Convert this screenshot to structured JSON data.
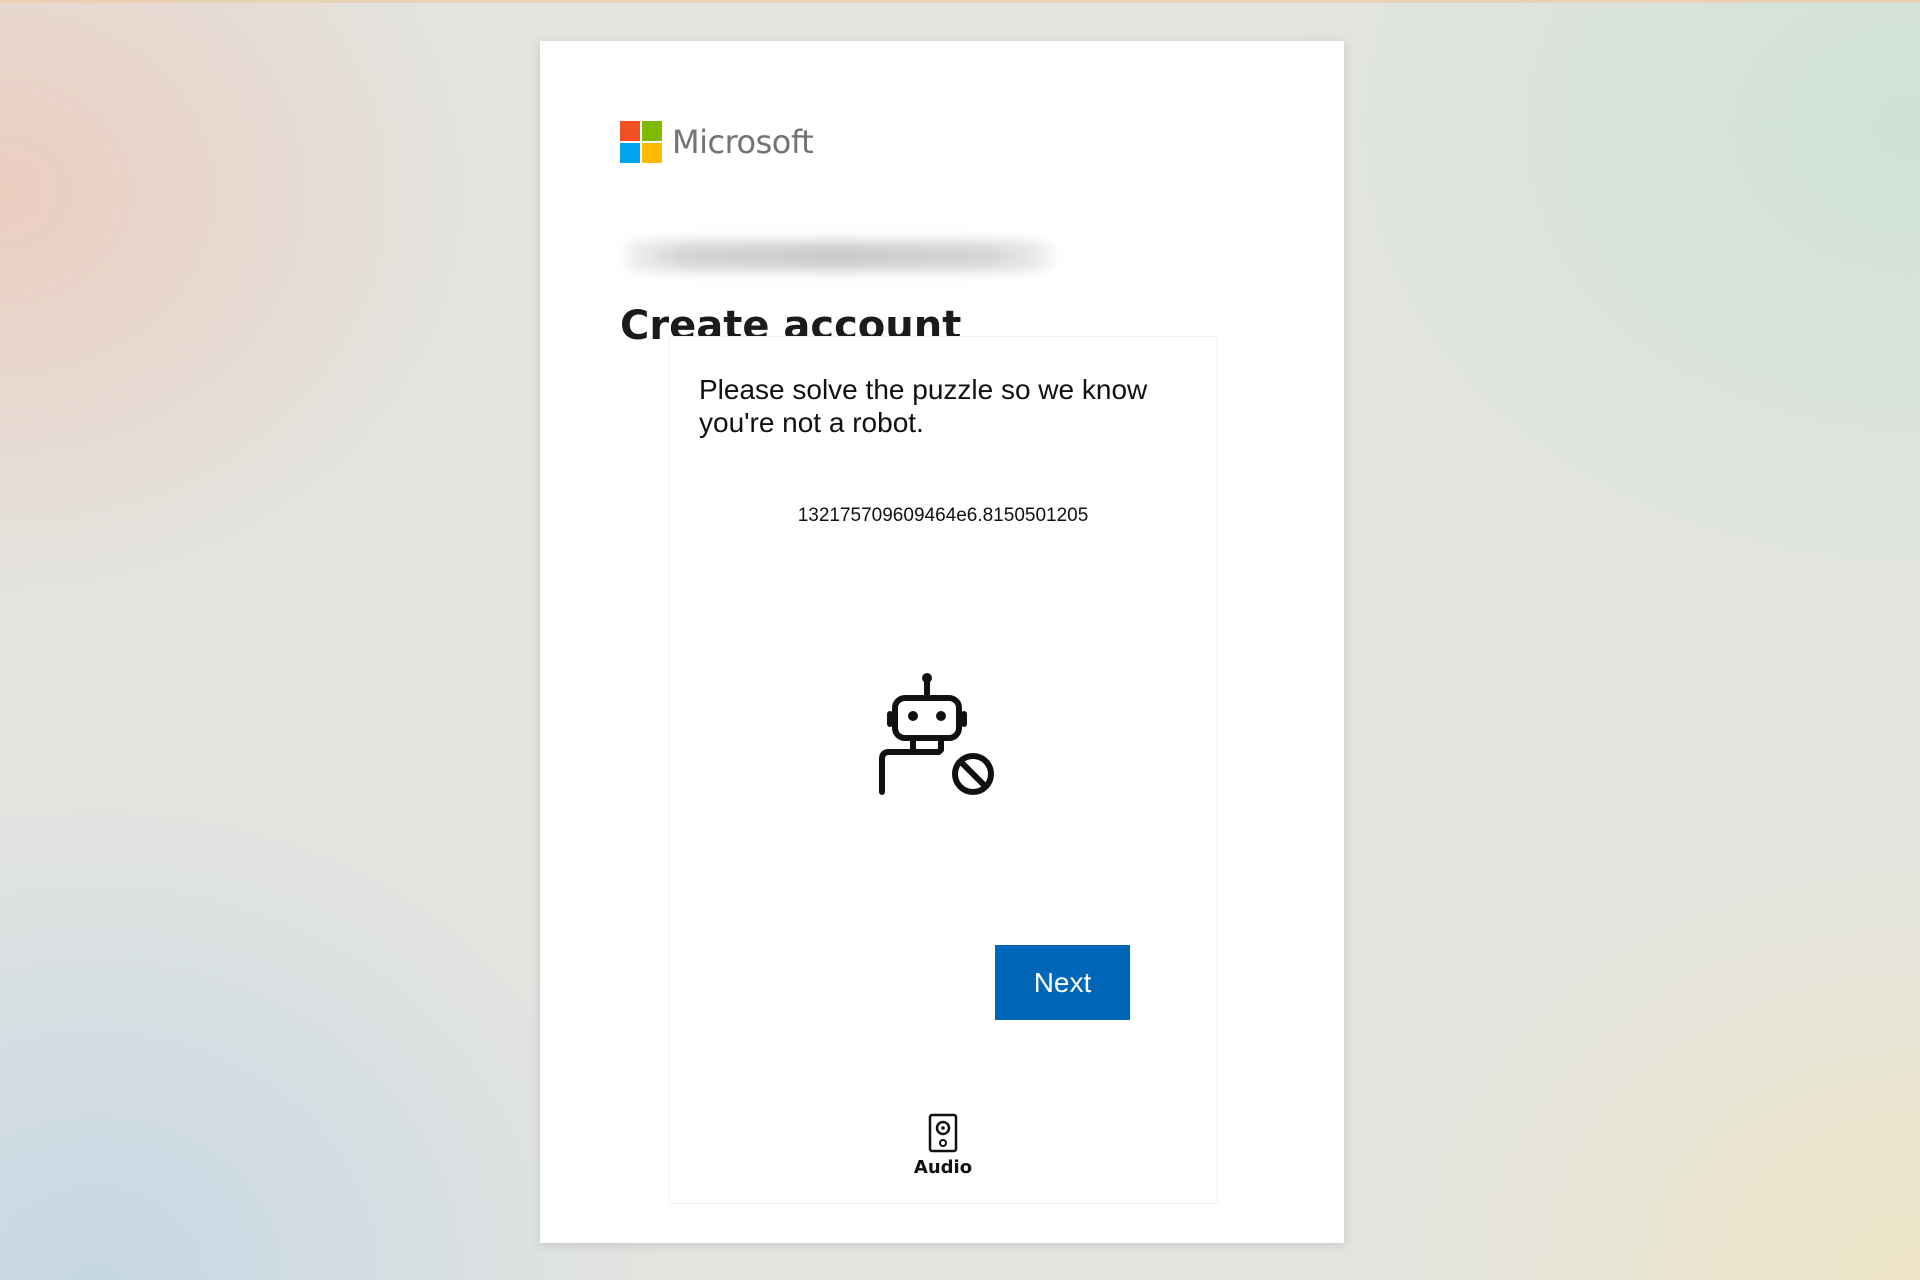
{
  "brand": {
    "name": "Microsoft",
    "logo_colors": [
      "#f25022",
      "#7fba00",
      "#00a4ef",
      "#ffb900"
    ]
  },
  "page": {
    "title": "Create account"
  },
  "puzzle": {
    "instructions": "Please solve the puzzle so we know you're not a robot.",
    "session_code": "1321757096094​64e6.8150501205",
    "icon": "robot-blocked-icon",
    "next_label": "Next",
    "audio_label": "Audio",
    "audio_icon": "speaker-icon"
  },
  "colors": {
    "primary_button": "#0067b8"
  }
}
